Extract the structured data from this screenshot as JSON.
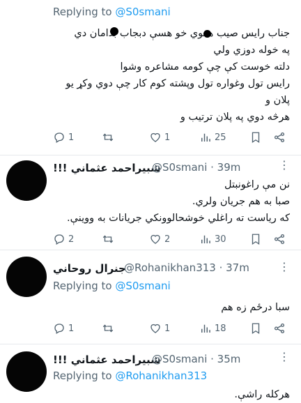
{
  "tweets": [
    {
      "replying_prefix": "Replying to ",
      "replying_to": "@S0smani",
      "lines": [
        "جناب رایس صیب هغوي خو هسې دبجاب بدامان دي",
        "په خوله دوزي ولي",
        "دلته خوست کې چې کومه مشاعره وشوا",
        "رایس تول وغواره تول وپشته کوم کار چې دوي وکړ یو",
        "پلان و",
        "هرڅه دوي په پلان ترتیب و"
      ],
      "stats": {
        "replies": "1",
        "reposts": "",
        "likes": "1",
        "views": "25"
      }
    },
    {
      "name": "شبيراحمد عثماني !!!",
      "handle": "@S0smani · 39m",
      "lines": [
        "نن مې راغونبتل",
        "صبا به هم جریان ولري.",
        "که ریاست ته راغلي خوشحالوونکي جریانات به ووینې."
      ],
      "stats": {
        "replies": "2",
        "reposts": "",
        "likes": "2",
        "views": "30"
      }
    },
    {
      "name": "جنرال روحاني",
      "handle": "@Rohanikhan313 · 37m",
      "replying_prefix": "Replying to ",
      "replying_to": "@S0smani",
      "lines": [
        "سبا درځم زه هم"
      ],
      "stats": {
        "replies": "1",
        "reposts": "",
        "likes": "1",
        "views": "18"
      }
    },
    {
      "name": "شبيراحمد عثماني !!!",
      "handle": "@S0smani · 35m",
      "replying_prefix": "Replying to ",
      "replying_to": "@Rohanikhan313",
      "lines": [
        "هرکله راشې."
      ]
    }
  ],
  "colors": {
    "accent": "#1d9bf0",
    "muted": "#536471",
    "text": "#0f1419"
  },
  "icons": [
    "more-icon",
    "reply-icon",
    "repost-icon",
    "like-icon",
    "views-icon",
    "bookmark-icon",
    "share-icon"
  ]
}
